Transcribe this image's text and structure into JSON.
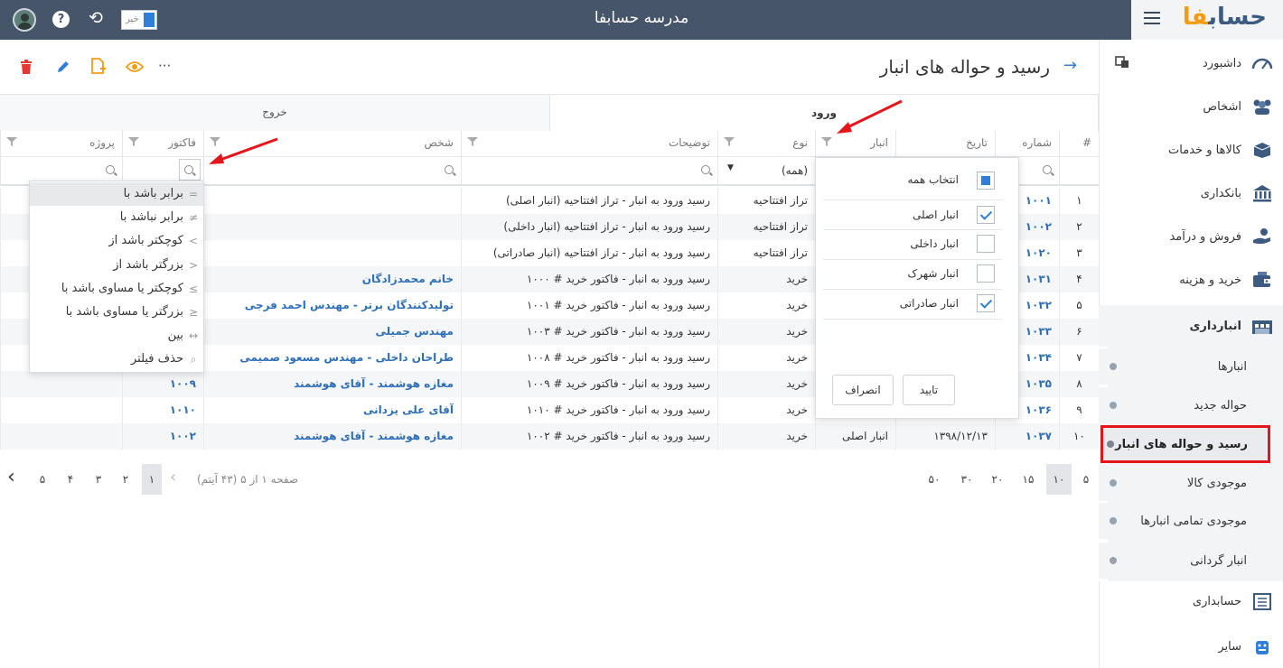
{
  "app": {
    "title": "مدرسه حسابفا",
    "logo_main": "حساب",
    "logo_accent": "فا",
    "toggle_label": "خیر"
  },
  "sidebar": {
    "items": [
      {
        "label": "داشبورد",
        "icon": "dashboard-icon"
      },
      {
        "label": "اشخاص",
        "icon": "people-icon"
      },
      {
        "label": "کالاها و خدمات",
        "icon": "box-icon"
      },
      {
        "label": "بانکداری",
        "icon": "bank-icon"
      },
      {
        "label": "فروش و درآمد",
        "icon": "sales-icon"
      },
      {
        "label": "خرید و هزینه",
        "icon": "purchase-icon"
      },
      {
        "label": "انبارداری",
        "icon": "warehouse-icon"
      }
    ],
    "sub_items": [
      "انبارها",
      "حواله جدید",
      "رسید و حواله های انبار",
      "موجودی کالا",
      "موجودی تمامی انبارها",
      "انبار گردانی"
    ],
    "bottom_items": [
      {
        "label": "حسابداری",
        "icon": "accounting-icon"
      },
      {
        "label": "سایر",
        "icon": "other-icon"
      }
    ]
  },
  "page": {
    "title": "رسید و حواله های انبار"
  },
  "toolbar": {
    "more": "···"
  },
  "tabs": {
    "in": "ورود",
    "out": "خروج"
  },
  "columns": {
    "num": "#",
    "number": "شماره",
    "date": "تاریخ",
    "warehouse": "انبار",
    "type": "نوع",
    "desc": "توضیحات",
    "person": "شخص",
    "invoice": "فاکتور",
    "project": "پروژه"
  },
  "type_filter": "(همه)",
  "rows": [
    {
      "num": "۱",
      "number": "۱۰۰۱",
      "date": "",
      "warehouse": "",
      "type": "تراز افتتاحیه",
      "desc": "رسید ورود به انبار - تراز افتتاحیه (انبار اصلی)",
      "person": "",
      "invoice": ""
    },
    {
      "num": "۲",
      "number": "۱۰۰۲",
      "date": "",
      "warehouse": "",
      "type": "تراز افتتاحیه",
      "desc": "رسید ورود به انبار - تراز افتتاحیه (انبار داخلی)",
      "person": "",
      "invoice": ""
    },
    {
      "num": "۳",
      "number": "۱۰۲۰",
      "date": "",
      "warehouse": "",
      "type": "تراز افتتاحیه",
      "desc": "رسید ورود به انبار - تراز افتتاحیه (انبار صادراتی)",
      "person": "",
      "invoice": ""
    },
    {
      "num": "۴",
      "number": "۱۰۳۱",
      "date": "",
      "warehouse": "",
      "type": "خرید",
      "desc": "رسید ورود به انبار - فاکتور خرید # ۱۰۰۰",
      "person": "خانم محمدزادگان",
      "invoice": ""
    },
    {
      "num": "۵",
      "number": "۱۰۳۲",
      "date": "",
      "warehouse": "",
      "type": "خرید",
      "desc": "رسید ورود به انبار - فاکتور خرید # ۱۰۰۱",
      "person": "تولیدکنندگان برتر - مهندس احمد فرجی",
      "invoice": ""
    },
    {
      "num": "۶",
      "number": "۱۰۳۳",
      "date": "",
      "warehouse": "",
      "type": "خرید",
      "desc": "رسید ورود به انبار - فاکتور خرید # ۱۰۰۳",
      "person": "مهندس جمیلی",
      "invoice": ""
    },
    {
      "num": "۷",
      "number": "۱۰۳۴",
      "date": "",
      "warehouse": "",
      "type": "خرید",
      "desc": "رسید ورود به انبار - فاکتور خرید # ۱۰۰۸",
      "person": "طراحان داخلی - مهندس مسعود صمیمی",
      "invoice": ""
    },
    {
      "num": "۸",
      "number": "۱۰۳۵",
      "date": "",
      "warehouse": "",
      "type": "خرید",
      "desc": "رسید ورود به انبار - فاکتور خرید # ۱۰۰۹",
      "person": "مغازه هوشمند - آقای هوشمند",
      "invoice": "۱۰۰۹"
    },
    {
      "num": "۹",
      "number": "۱۰۳۶",
      "date": "",
      "warehouse": "",
      "type": "خرید",
      "desc": "رسید ورود به انبار - فاکتور خرید # ۱۰۱۰",
      "person": "آقای علی یزدانی",
      "invoice": "۱۰۱۰"
    },
    {
      "num": "۱۰",
      "number": "۱۰۳۷",
      "date": "۱۳۹۸/۱۲/۱۳",
      "warehouse": "انبار اصلی",
      "type": "خرید",
      "desc": "رسید ورود به انبار - فاکتور خرید # ۱۰۰۲",
      "person": "مغازه هوشمند - آقای هوشمند",
      "invoice": "۱۰۰۲"
    }
  ],
  "pager": {
    "sizes": [
      "۵",
      "۱۰",
      "۱۵",
      "۲۰",
      "۳۰",
      "۵۰"
    ],
    "active_size": "۱۰",
    "info": "صفحه ۱ از ۵ (۴۳ آیتم)",
    "pages": [
      "۱",
      "۲",
      "۳",
      "۴",
      "۵"
    ]
  },
  "warehouse_popup": {
    "select_all": "انتخاب همه",
    "options": [
      {
        "label": "انبار اصلی",
        "checked": true
      },
      {
        "label": "انبار داخلی",
        "checked": false
      },
      {
        "label": "انبار شهرک",
        "checked": false
      },
      {
        "label": "انبار صادراتی",
        "checked": true
      }
    ],
    "ok": "تایید",
    "cancel": "انصراف"
  },
  "compare_popup": [
    {
      "label": "برابر باشد با",
      "sym": "="
    },
    {
      "label": "برابر نباشد با",
      "sym": "≠"
    },
    {
      "label": "کوچکتر باشد از",
      "sym": ">"
    },
    {
      "label": "بزرگتر باشد از",
      "sym": "<"
    },
    {
      "label": "کوچکتر یا مساوی باشد با",
      "sym": "≥"
    },
    {
      "label": "بزرگتر یا مساوی باشد با",
      "sym": "≤"
    },
    {
      "label": "بین",
      "sym": "↔"
    },
    {
      "label": "حذف فیلتر",
      "sym": "⌕"
    }
  ],
  "colors": {
    "topbar": "#46556a",
    "accent": "#2f7ed8",
    "link": "#2f6fb5",
    "highlight": "#e4161b",
    "logo_accent": "#f39c12"
  }
}
